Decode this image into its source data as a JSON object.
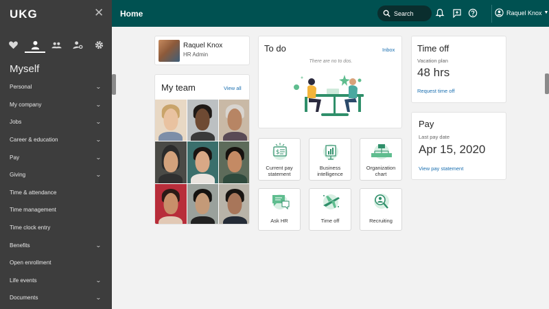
{
  "app": {
    "logo": "UKG"
  },
  "sidebar": {
    "section_title": "Myself",
    "items": [
      {
        "label": "Personal",
        "chevron": true
      },
      {
        "label": "My company",
        "chevron": true
      },
      {
        "label": "Jobs",
        "chevron": true
      },
      {
        "label": "Career & education",
        "chevron": true
      },
      {
        "label": "Pay",
        "chevron": true
      },
      {
        "label": "Giving",
        "chevron": true
      },
      {
        "label": "Time & attendance",
        "chevron": false
      },
      {
        "label": "Time management",
        "chevron": false
      },
      {
        "label": "Time clock entry",
        "chevron": false
      },
      {
        "label": "Benefits",
        "chevron": true
      },
      {
        "label": "Open enrollment",
        "chevron": false
      },
      {
        "label": "Life events",
        "chevron": true
      },
      {
        "label": "Documents",
        "chevron": true
      }
    ],
    "icons": [
      "heart-icon",
      "person-icon",
      "team-icon",
      "person-settings-icon",
      "gear-icon"
    ]
  },
  "header": {
    "title": "Home",
    "search_label": "Search",
    "user_name": "Raquel Knox"
  },
  "profile": {
    "name": "Raquel Knox",
    "role": "HR Admin"
  },
  "team": {
    "title": "My team",
    "view_all": "View all"
  },
  "todo": {
    "title": "To do",
    "link": "Inbox",
    "empty_text": "There are no to dos."
  },
  "tiles": [
    {
      "label": "Current pay statement",
      "icon": "pay-statement-icon"
    },
    {
      "label": "Business intelligence",
      "icon": "business-intelligence-icon"
    },
    {
      "label": "Organization chart",
      "icon": "org-chart-icon"
    },
    {
      "label": "Ask HR",
      "icon": "ask-hr-icon"
    },
    {
      "label": "Time off",
      "icon": "time-off-icon"
    },
    {
      "label": "Recruiting",
      "icon": "recruiting-icon"
    }
  ],
  "time_off": {
    "title": "Time off",
    "plan_label": "Vacation plan",
    "value": "48 hrs",
    "link": "Request time off"
  },
  "pay": {
    "title": "Pay",
    "date_label": "Last pay date",
    "date": "Apr 15, 2020",
    "link": "View pay statement"
  },
  "colors": {
    "header": "#005151",
    "sidebar": "#3d3d3d",
    "link": "#1a6fb0",
    "accent_green": "#2e9b6a"
  }
}
